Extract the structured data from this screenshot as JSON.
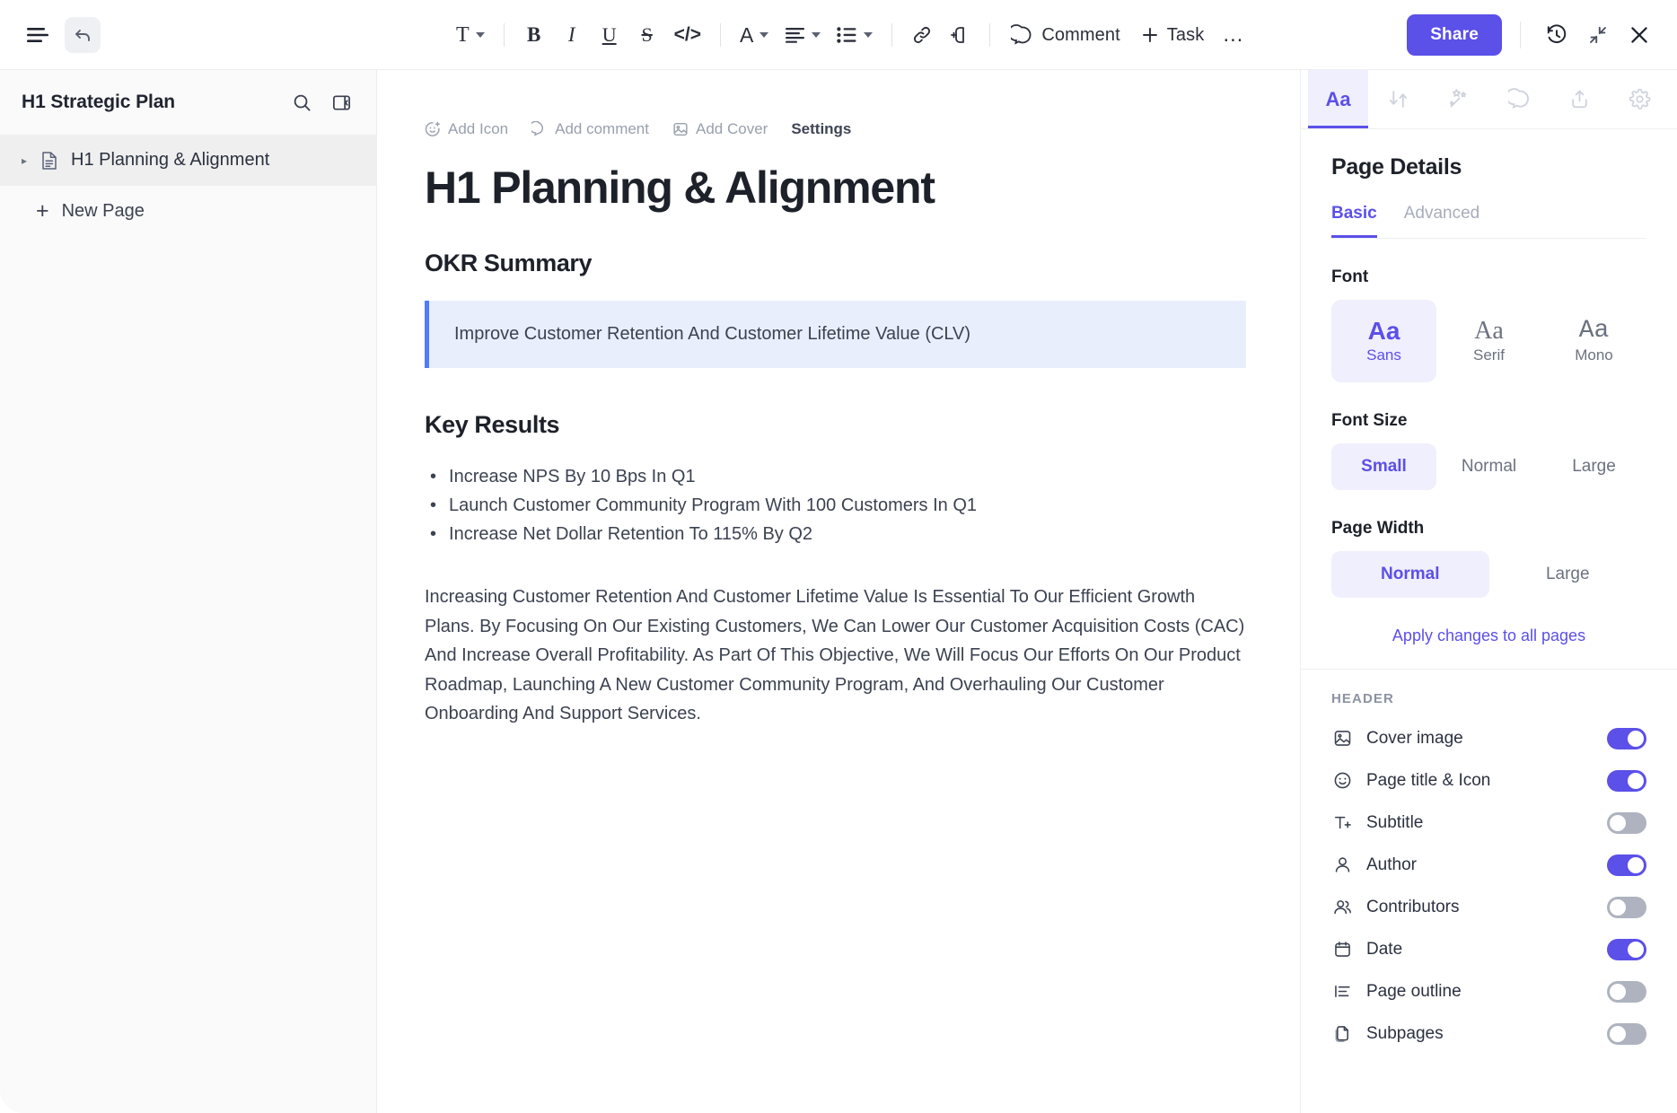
{
  "toolbar": {
    "menu_icon": "hamburger-menu-icon",
    "undo_icon": "undo-arrow-icon",
    "text_style_label": "T",
    "bold_label": "B",
    "italic_label": "I",
    "underline_label": "U",
    "strikethrough_label": "S",
    "code_label": "</>",
    "font_color_label": "A",
    "comment_label": "Comment",
    "task_label": "Task",
    "more_label": "…",
    "share_label": "Share",
    "history_icon": "clock-history-icon",
    "collapse_icon": "collapse-arrows-icon",
    "close_icon": "close-x-icon"
  },
  "sidebar": {
    "title": "H1 Strategic Plan",
    "search_icon": "search-icon",
    "panel_toggle_icon": "sidebar-collapse-icon",
    "items": [
      {
        "label": "H1 Planning & Alignment",
        "icon": "document-icon",
        "active": true
      }
    ],
    "new_page_label": "New Page"
  },
  "document": {
    "actions": [
      {
        "label": "Add Icon",
        "icon": "smiley-plus-icon",
        "active": false
      },
      {
        "label": "Add comment",
        "icon": "comment-icon",
        "active": false
      },
      {
        "label": "Add Cover",
        "icon": "image-icon",
        "active": false
      },
      {
        "label": "Settings",
        "icon": "",
        "active": true
      }
    ],
    "title": "H1 Planning & Alignment",
    "okr_heading": "OKR Summary",
    "okr_callout": "Improve Customer Retention And Customer Lifetime Value (CLV)",
    "key_results_heading": "Key Results",
    "key_results": [
      "Increase NPS By 10 Bps In Q1",
      "Launch Customer Community Program With 100 Customers In Q1",
      "Increase Net Dollar Retention To 115% By Q2"
    ],
    "paragraph": "Increasing Customer Retention And Customer Lifetime Value Is Essential To Our Efficient Growth Plans. By Focusing On Our Existing Customers, We Can Lower Our Customer Acquisition Costs (CAC) And Increase Overall Profitability. As Part Of This Objective, We Will Focus Our Efforts On Our Product Roadmap, Launching A New Customer Community Program, And Overhauling Our Customer Onboarding And Support Services."
  },
  "panel": {
    "tabs": [
      {
        "label": "Aa",
        "icon": "typography-icon",
        "active": true
      },
      {
        "label": "",
        "icon": "relationships-arrows-icon",
        "active": false
      },
      {
        "label": "",
        "icon": "magic-wand-icon",
        "active": false
      },
      {
        "label": "",
        "icon": "comment-bubble-icon",
        "active": false
      },
      {
        "label": "",
        "icon": "share-upload-icon",
        "active": false
      },
      {
        "label": "",
        "icon": "gear-icon",
        "active": false
      }
    ],
    "title": "Page Details",
    "sub_tabs": [
      {
        "label": "Basic",
        "active": true
      },
      {
        "label": "Advanced",
        "active": false
      }
    ],
    "font_label": "Font",
    "font_options": [
      {
        "glyph": "Aa",
        "name": "Sans",
        "active": true
      },
      {
        "glyph": "Aa",
        "name": "Serif",
        "active": false
      },
      {
        "glyph": "Aa",
        "name": "Mono",
        "active": false
      }
    ],
    "font_size_label": "Font Size",
    "font_size_options": [
      {
        "label": "Small",
        "active": true
      },
      {
        "label": "Normal",
        "active": false
      },
      {
        "label": "Large",
        "active": false
      }
    ],
    "page_width_label": "Page Width",
    "page_width_options": [
      {
        "label": "Normal",
        "active": true
      },
      {
        "label": "Large",
        "active": false
      }
    ],
    "apply_link": "Apply changes to all pages",
    "header_section_label": "HEADER",
    "header_toggles": [
      {
        "label": "Cover image",
        "icon": "image-icon",
        "on": true
      },
      {
        "label": "Page title & Icon",
        "icon": "smiley-icon",
        "on": true
      },
      {
        "label": "Subtitle",
        "icon": "text-plus-icon",
        "on": false
      },
      {
        "label": "Author",
        "icon": "person-icon",
        "on": true
      },
      {
        "label": "Contributors",
        "icon": "people-icon",
        "on": false
      },
      {
        "label": "Date",
        "icon": "calendar-icon",
        "on": true
      },
      {
        "label": "Page outline",
        "icon": "list-outline-icon",
        "on": false
      },
      {
        "label": "Subpages",
        "icon": "pages-icon",
        "on": false
      }
    ]
  },
  "colors": {
    "accent": "#5b50e8",
    "callout_bg": "#e9eefc",
    "callout_bar": "#4f7df5",
    "sidebar_bg": "#fafafa",
    "active_row": "#efefef"
  }
}
